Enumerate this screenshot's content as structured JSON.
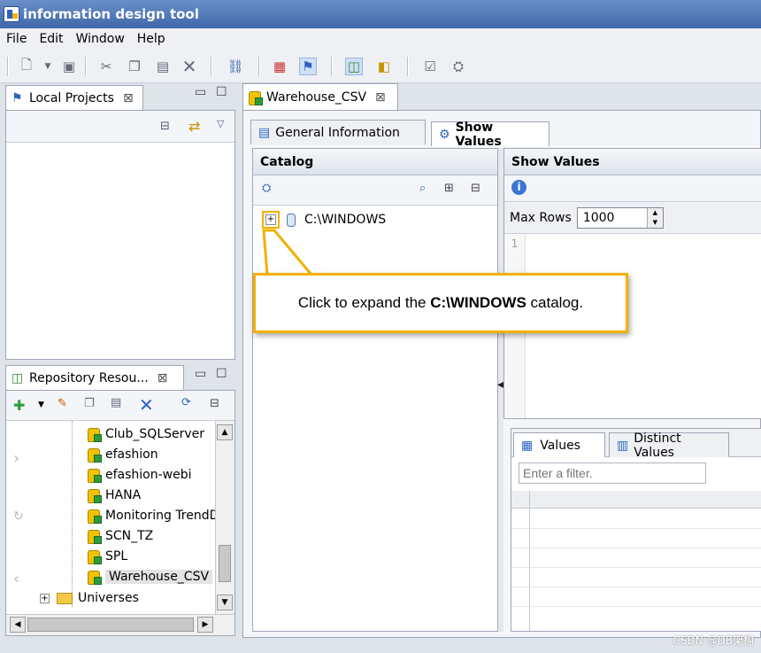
{
  "window": {
    "title": "information design tool"
  },
  "menu": [
    "File",
    "Edit",
    "Window",
    "Help"
  ],
  "local_projects": {
    "title": "Local Projects"
  },
  "repository": {
    "title": "Repository Resou...",
    "items": [
      "Club_SQLServer",
      "efashion",
      "efashion-webi",
      "HANA",
      "Monitoring TrendDI",
      "SCN_TZ",
      "SPL",
      "Warehouse_CSV"
    ],
    "selected": "Warehouse_CSV",
    "folder": "Universes"
  },
  "editor": {
    "tab_title": "Warehouse_CSV",
    "subtabs": [
      "General Information",
      "Show Values"
    ],
    "active_subtab": "Show Values"
  },
  "catalog": {
    "header": "Catalog",
    "root": "C:\\WINDOWS",
    "callout_prefix": "Click to expand the ",
    "callout_bold": "C:\\WINDOWS",
    "callout_suffix": " catalog."
  },
  "show_values": {
    "header": "Show Values",
    "max_rows_label": "Max Rows",
    "max_rows_value": "1000",
    "line_number": "1",
    "tabs": [
      "Values",
      "Distinct Values"
    ],
    "filter_placeholder": "Enter a filter."
  },
  "watermark": "CSDN @DB架构",
  "colors": {
    "accent": "#f5b000",
    "titlebar": "#3f67a8"
  }
}
